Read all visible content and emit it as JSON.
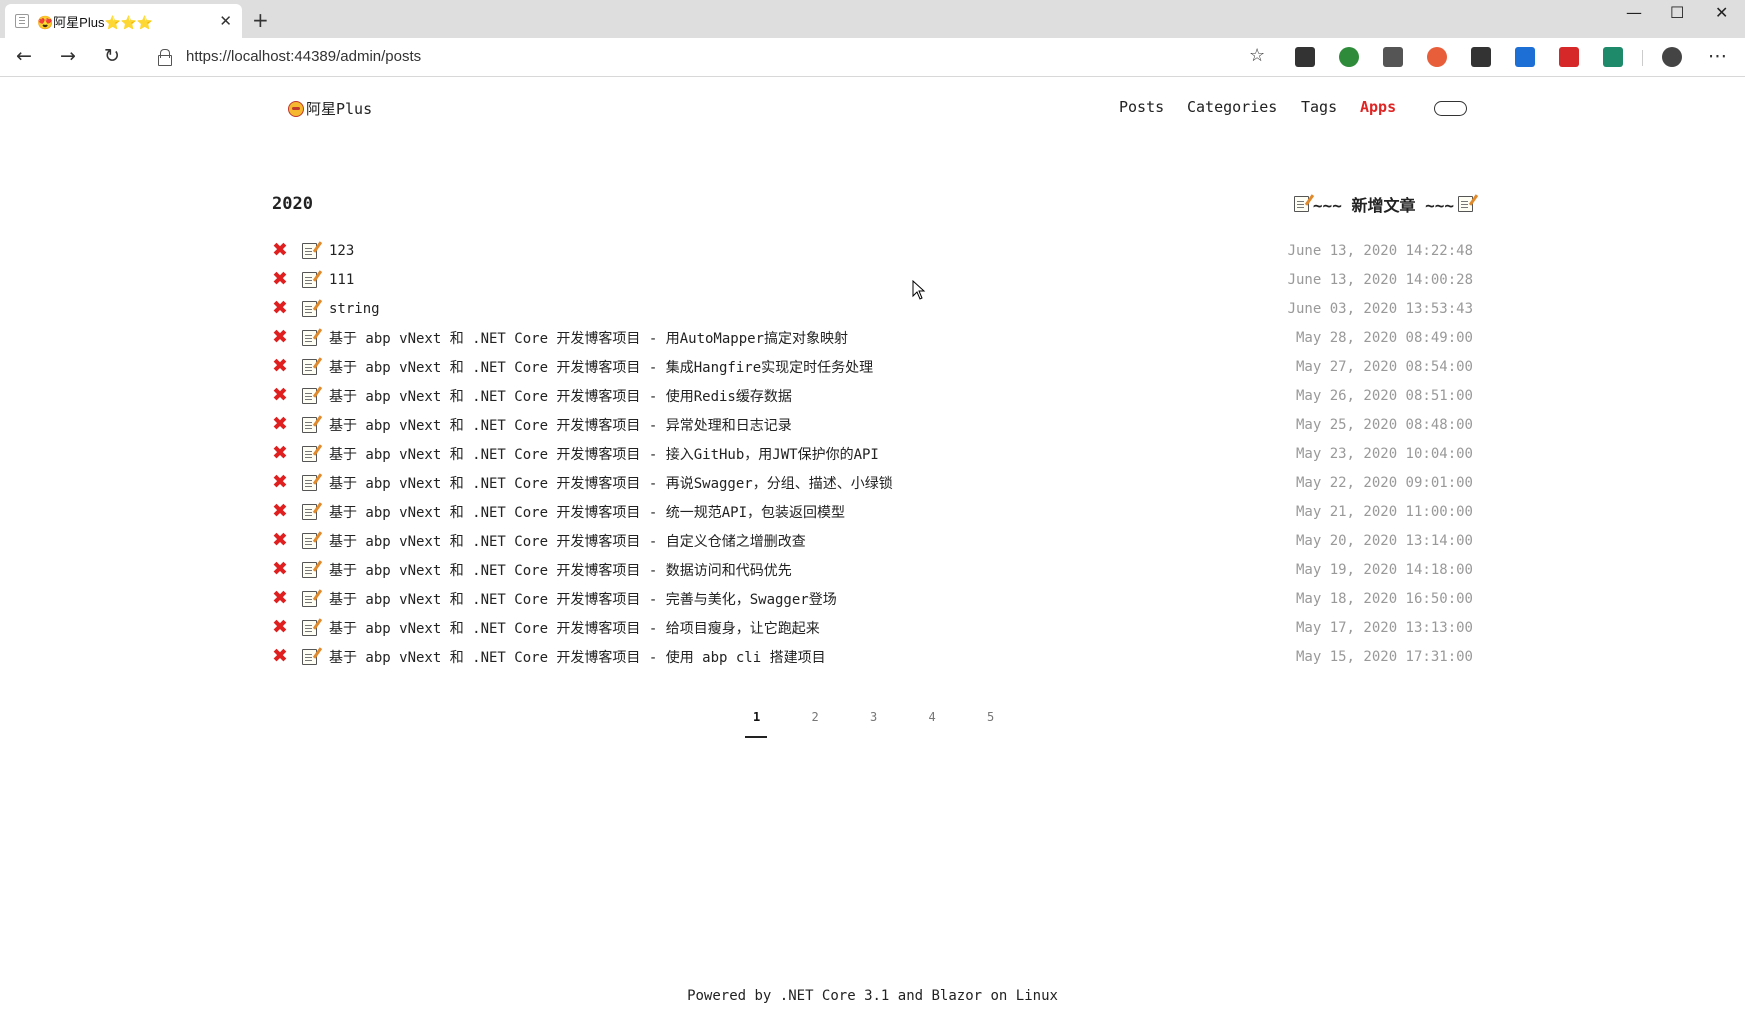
{
  "browser": {
    "tab_title": "😍阿星Plus⭐⭐⭐",
    "tab_close": "✕",
    "new_tab": "+",
    "url": "https://localhost:44389/admin/posts",
    "window_controls": {
      "minimize": "—",
      "maximize": "☐",
      "close": "✕"
    },
    "nav": {
      "back": "←",
      "forward": "→",
      "reload": "↻",
      "star": "☆",
      "menu": "⋯"
    }
  },
  "site": {
    "brand": "阿星Plus",
    "nav": [
      {
        "label": "Posts",
        "active": false
      },
      {
        "label": "Categories",
        "active": false
      },
      {
        "label": "Tags",
        "active": false
      },
      {
        "label": "Apps",
        "active": true
      }
    ]
  },
  "main": {
    "year": "2020",
    "new_post_label": "~~~ 新增文章 ~~~",
    "delete_symbol": "✖",
    "posts": [
      {
        "title": "123",
        "date": "June 13, 2020 14:22:48"
      },
      {
        "title": "111",
        "date": "June 13, 2020 14:00:28"
      },
      {
        "title": "string",
        "date": "June 03, 2020 13:53:43"
      },
      {
        "title": "基于 abp vNext 和 .NET Core 开发博客项目 - 用AutoMapper搞定对象映射",
        "date": "May 28, 2020 08:49:00"
      },
      {
        "title": "基于 abp vNext 和 .NET Core 开发博客项目 - 集成Hangfire实现定时任务处理",
        "date": "May 27, 2020 08:54:00"
      },
      {
        "title": "基于 abp vNext 和 .NET Core 开发博客项目 - 使用Redis缓存数据",
        "date": "May 26, 2020 08:51:00"
      },
      {
        "title": "基于 abp vNext 和 .NET Core 开发博客项目 - 异常处理和日志记录",
        "date": "May 25, 2020 08:48:00"
      },
      {
        "title": "基于 abp vNext 和 .NET Core 开发博客项目 - 接入GitHub，用JWT保护你的API",
        "date": "May 23, 2020 10:04:00"
      },
      {
        "title": "基于 abp vNext 和 .NET Core 开发博客项目 - 再说Swagger，分组、描述、小绿锁",
        "date": "May 22, 2020 09:01:00"
      },
      {
        "title": "基于 abp vNext 和 .NET Core 开发博客项目 - 统一规范API，包装返回模型",
        "date": "May 21, 2020 11:00:00"
      },
      {
        "title": "基于 abp vNext 和 .NET Core 开发博客项目 - 自定义仓储之增删改查",
        "date": "May 20, 2020 13:14:00"
      },
      {
        "title": "基于 abp vNext 和 .NET Core 开发博客项目 - 数据访问和代码优先",
        "date": "May 19, 2020 14:18:00"
      },
      {
        "title": "基于 abp vNext 和 .NET Core 开发博客项目 - 完善与美化，Swagger登场",
        "date": "May 18, 2020 16:50:00"
      },
      {
        "title": "基于 abp vNext 和 .NET Core 开发博客项目 - 给项目瘦身，让它跑起来",
        "date": "May 17, 2020 13:13:00"
      },
      {
        "title": "基于 abp vNext 和 .NET Core 开发博客项目 - 使用 abp cli 搭建项目",
        "date": "May 15, 2020 17:31:00"
      }
    ]
  },
  "pagination": {
    "pages": [
      "1",
      "2",
      "3",
      "4",
      "5"
    ],
    "current": "1"
  },
  "footer": {
    "text": "Powered by .NET Core 3.1 and Blazor on Linux"
  },
  "colors": {
    "accent": "#e02424",
    "delete": "#e02020",
    "date": "#999999"
  }
}
